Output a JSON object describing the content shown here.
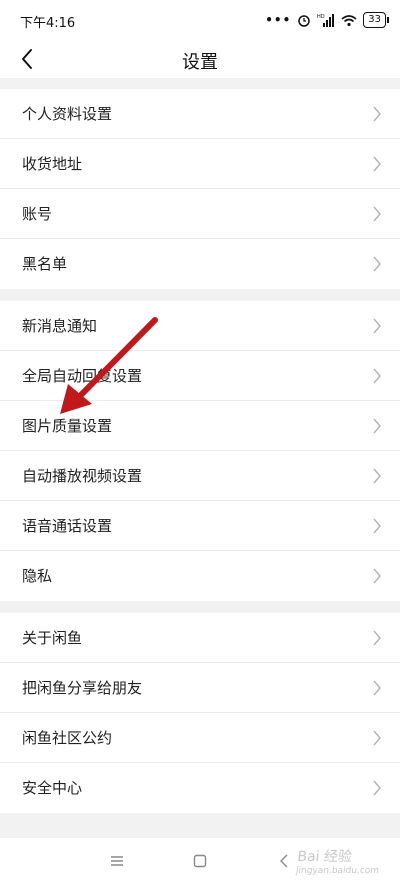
{
  "status": {
    "time": "下午4:16",
    "signal_label": "HD",
    "battery": "33"
  },
  "header": {
    "title": "设置"
  },
  "groups": [
    {
      "items": [
        {
          "label": "个人资料设置"
        },
        {
          "label": "收货地址"
        },
        {
          "label": "账号"
        },
        {
          "label": "黑名单"
        }
      ]
    },
    {
      "items": [
        {
          "label": "新消息通知"
        },
        {
          "label": "全局自动回复设置"
        },
        {
          "label": "图片质量设置"
        },
        {
          "label": "自动播放视频设置"
        },
        {
          "label": "语音通话设置"
        },
        {
          "label": "隐私"
        }
      ]
    },
    {
      "items": [
        {
          "label": "关于闲鱼"
        },
        {
          "label": "把闲鱼分享给朋友"
        },
        {
          "label": "闲鱼社区公约"
        },
        {
          "label": "安全中心"
        }
      ]
    }
  ],
  "watermark": {
    "text": "Bai 经验",
    "sub": "jingyan.baidu.com"
  },
  "colors": {
    "annotation_arrow": "#c0191b",
    "background": "#f2f2f2"
  }
}
